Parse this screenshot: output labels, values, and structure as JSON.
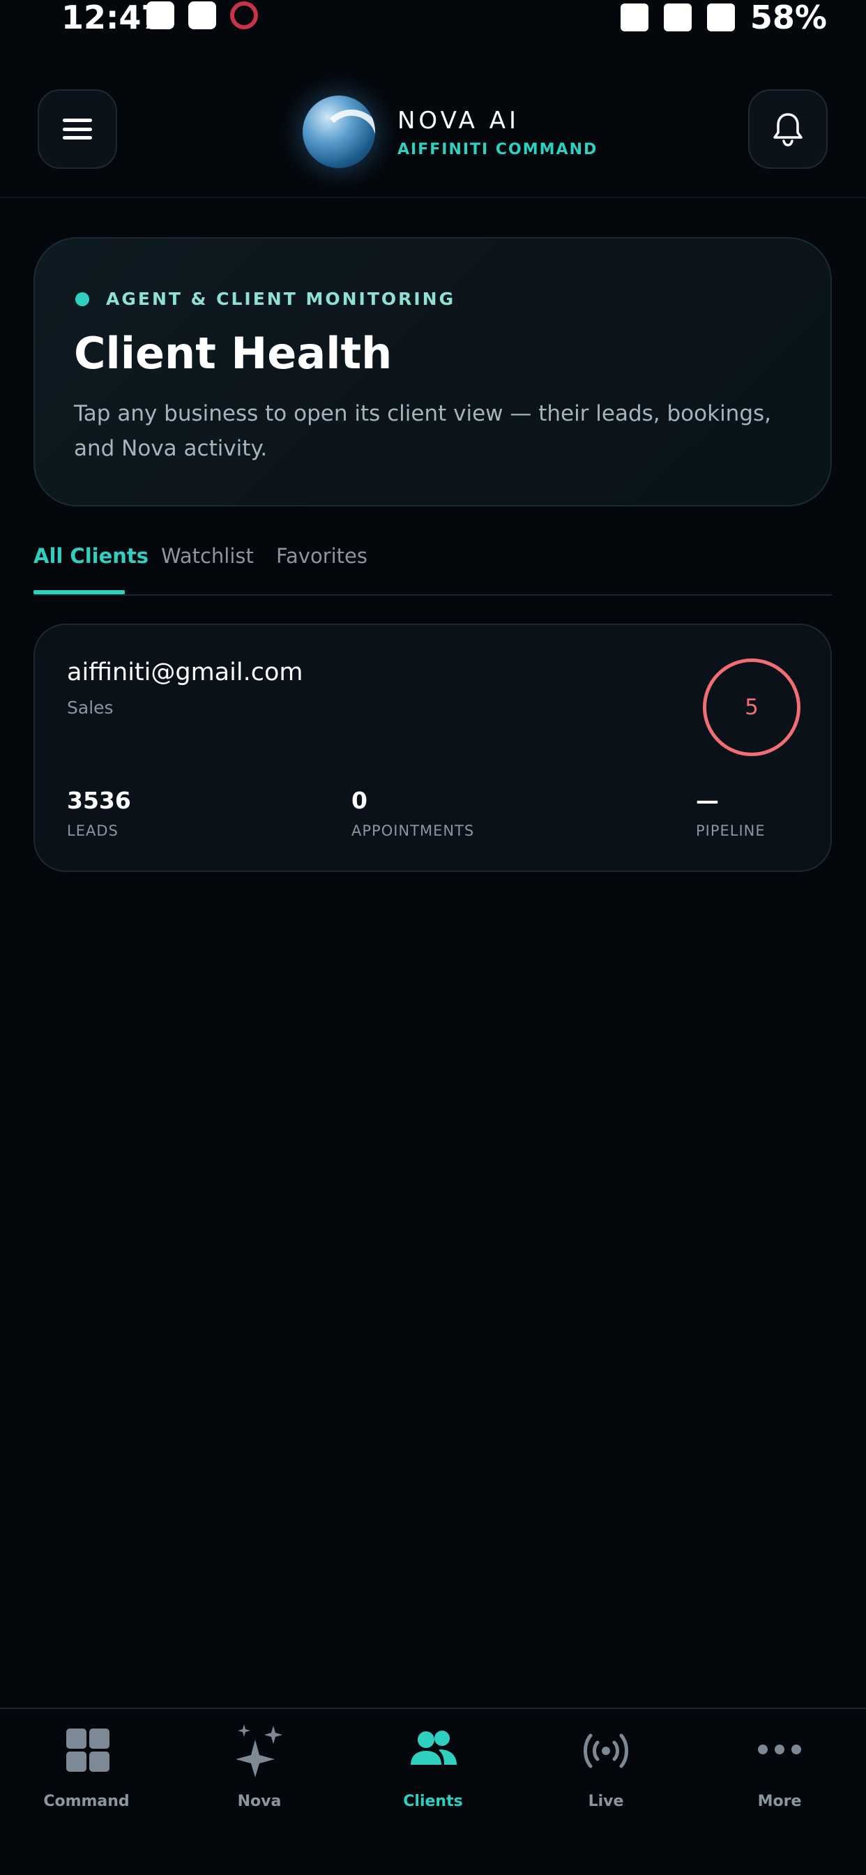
{
  "status_bar": {
    "time": "12:47",
    "battery": "58%"
  },
  "header": {
    "brand_title": "NOVA AI",
    "brand_subtitle": "AIFFINITI COMMAND"
  },
  "hero": {
    "eyebrow": "AGENT & CLIENT MONITORING",
    "title": "Client Health",
    "description": "Tap any business to open its client view — their leads, bookings, and Nova activity."
  },
  "tabs": [
    {
      "label": "All Clients",
      "active": true
    },
    {
      "label": "Watchlist",
      "active": false
    },
    {
      "label": "Favorites",
      "active": false
    }
  ],
  "clients": [
    {
      "email": "aiffiniti@gmail.com",
      "type": "Sales",
      "score": "5",
      "stats": [
        {
          "value": "3536",
          "label": "LEADS"
        },
        {
          "value": "0",
          "label": "APPOINTMENTS"
        },
        {
          "value": "—",
          "label": "PIPELINE"
        }
      ]
    }
  ],
  "bottom_nav": [
    {
      "label": "Command",
      "icon": "grid-icon",
      "active": false
    },
    {
      "label": "Nova",
      "icon": "sparkle-icon",
      "active": false
    },
    {
      "label": "Clients",
      "icon": "users-icon",
      "active": true
    },
    {
      "label": "Live",
      "icon": "broadcast-icon",
      "active": false
    },
    {
      "label": "More",
      "icon": "more-dots-icon",
      "active": false
    }
  ],
  "colors": {
    "accent": "#2fd0c0",
    "alert": "#f06e74",
    "background": "#04070b"
  }
}
